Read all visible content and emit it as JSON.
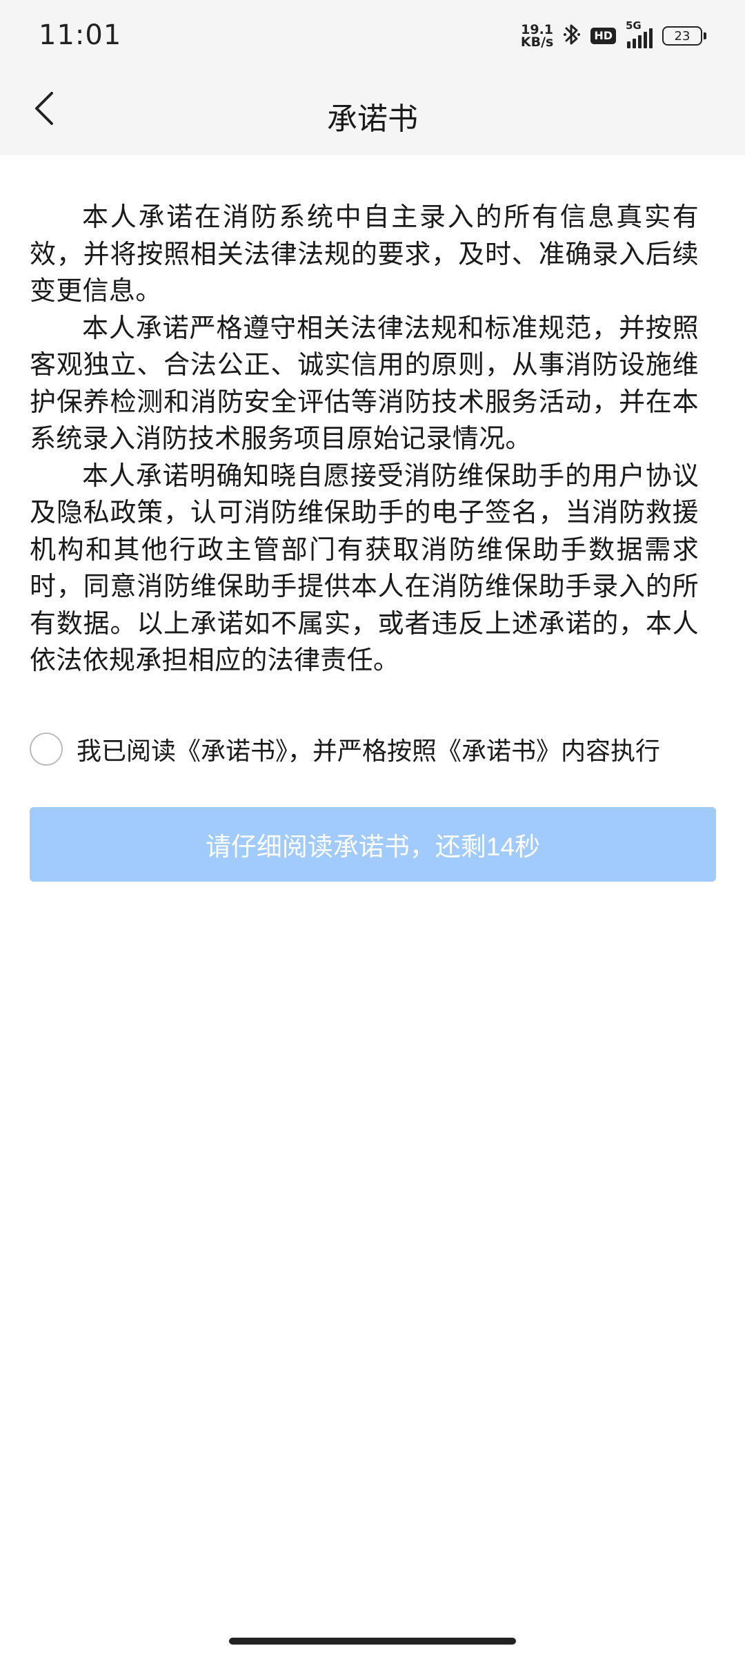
{
  "status_bar": {
    "time": "11:01",
    "net_speed_value": "19.1",
    "net_speed_unit": "KB/s",
    "bluetooth_icon": "bluetooth-icon",
    "hd_label": "HD",
    "network_type": "5G",
    "battery_level": "23"
  },
  "nav": {
    "back_icon": "chevron-left-icon",
    "title": "承诺书"
  },
  "content": {
    "paragraphs": [
      "本人承诺在消防系统中自主录入的所有信息真实有效，并将按照相关法律法规的要求，及时、准确录入后续变更信息。",
      "本人承诺严格遵守相关法律法规和标准规范，并按照客观独立、合法公正、诚实信用的原则，从事消防设施维护保养检测和消防安全评估等消防技术服务活动，并在本系统录入消防技术服务项目原始记录情况。",
      "本人承诺明确知晓自愿接受消防维保助手的用户协议及隐私政策，认可消防维保助手的电子签名，当消防救援机构和其他行政主管部门有获取消防维保助手数据需求时，同意消防维保助手提供本人在消防维保助手录入的所有数据。以上承诺如不属实，或者违反上述承诺的，本人依法依规承担相应的法律责任。"
    ]
  },
  "agreement": {
    "checked": false,
    "label": "我已阅读《承诺书》，并严格按照《承诺书》内容执行"
  },
  "confirm_button": {
    "label": "请仔细阅读承诺书，还剩14秒",
    "disabled": true,
    "color": "#a0cbfc"
  }
}
